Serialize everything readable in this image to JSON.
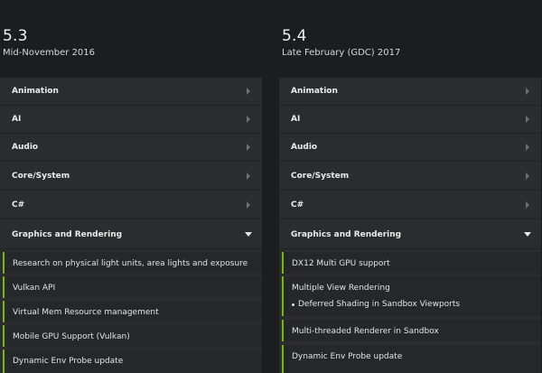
{
  "left": {
    "version": "5.3",
    "date": "Mid-November 2016",
    "categories": [
      "Animation",
      "AI",
      "Audio",
      "Core/System",
      "C#",
      "Graphics and Rendering"
    ],
    "items": [
      "Research on physical light units, area lights and exposure",
      "Vulkan API",
      "Virtual Mem Resource management",
      "Mobile GPU Support (Vulkan)",
      "Dynamic Env Probe update"
    ]
  },
  "right": {
    "version": "5.4",
    "date": "Late February (GDC) 2017",
    "categories": [
      "Animation",
      "AI",
      "Audio",
      "Core/System",
      "C#",
      "Graphics and Rendering"
    ],
    "items": [
      {
        "label": "DX12 Multi GPU support"
      },
      {
        "label": "Multiple View Rendering",
        "sub": "Deferred Shading in Sandbox Viewports"
      },
      {
        "label": "Multi-threaded Renderer in Sandbox"
      },
      {
        "label": "Dynamic Env Probe update"
      }
    ]
  },
  "colors": {
    "accent": "#76b900",
    "background": "#1b1d1f",
    "panel": "#2a2c2e"
  }
}
